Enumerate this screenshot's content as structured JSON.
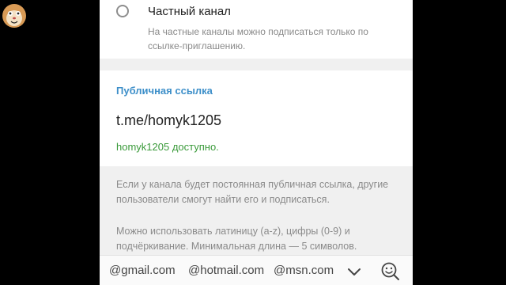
{
  "private_channel": {
    "label": "Частный канал",
    "description": "На частные каналы можно подписаться только по ссылке-приглашению."
  },
  "public_link": {
    "section_title": "Публичная ссылка",
    "value": "t.me/homyk1205",
    "status": "homyk1205 доступно."
  },
  "info": {
    "paragraph1": "Если у канала будет постоянная публичная ссылка, другие пользователи смогут найти его и подписаться.",
    "paragraph2": "Можно использовать латиницу (a-z), цифры (0-9) и подчёркивание. Минимальная длина — 5 символов."
  },
  "keyboard": {
    "suggestions": [
      "@gmail.com",
      "@hotmail.com",
      "@msn.com"
    ]
  },
  "colors": {
    "accent": "#3d8fc9",
    "success": "#3a9a3a"
  }
}
